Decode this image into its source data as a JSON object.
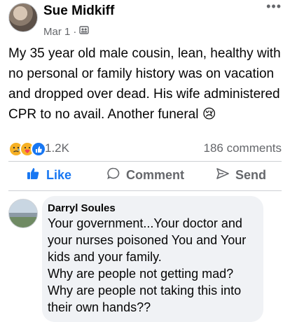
{
  "post": {
    "author": "Sue Midkiff",
    "date": "Mar 1",
    "separator": "·",
    "audience_icon": "friends-icon",
    "body": "My 35 year old male cousin, lean, healthy with no personal or family history was on vacation and dropped over dead.  His wife administered CPR to no avail.   Another funeral 😢"
  },
  "reactions": {
    "icons": [
      "sad",
      "care",
      "like"
    ],
    "count": "1.2K",
    "comments": "186 comments"
  },
  "actions": {
    "like": "Like",
    "comment": "Comment",
    "send": "Send"
  },
  "comment": {
    "author": "Darryl Soules",
    "text": "Your government...Your doctor and your nurses poisoned You and Your kids and your family.\nWhy are people not getting mad?\nWhy are people not taking this into their own hands??"
  },
  "colors": {
    "accent": "#1877f2",
    "secondary_text": "#65676b",
    "bubble": "#f0f2f5"
  }
}
